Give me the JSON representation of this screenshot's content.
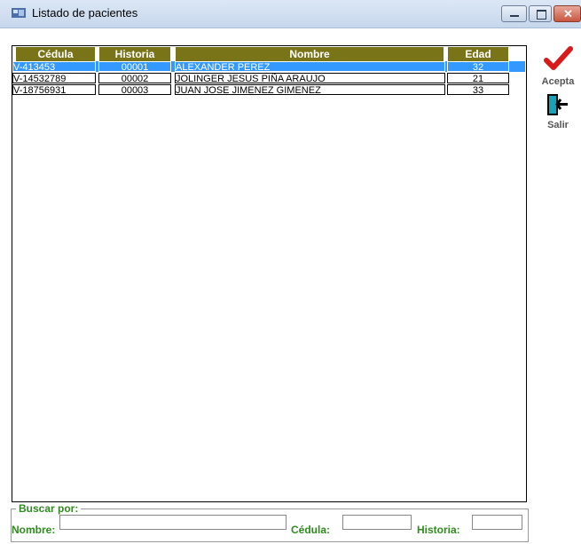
{
  "window": {
    "title": "Listado de pacientes"
  },
  "table": {
    "columns": [
      "Cédula",
      "Historia",
      "Nombre",
      "Edad"
    ],
    "rows": [
      {
        "cedula": "V-413453",
        "historia": "00001",
        "nombre": "ALEXANDER PEREZ",
        "edad": "32",
        "selected": true
      },
      {
        "cedula": "V-14532789",
        "historia": "00002",
        "nombre": "JOLINGER JESUS PIÑA  ARAUJO",
        "edad": "21",
        "selected": false
      },
      {
        "cedula": "V-18756931",
        "historia": "00003",
        "nombre": "JUAN JOSE JIMENEZ GIMENEZ",
        "edad": "33",
        "selected": false
      }
    ]
  },
  "toolbar": {
    "accept_label": "Acepta",
    "exit_label": "Salir"
  },
  "search": {
    "legend": "Buscar por:",
    "nombre_label": "Nombre:",
    "cedula_label": "Cédula:",
    "historia_label": "Historia:",
    "nombre_value": "",
    "cedula_value": "",
    "historia_value": ""
  },
  "colors": {
    "header_bg": "#7a7418",
    "selection": "#3399ff",
    "label_green": "#2e8b1e"
  }
}
